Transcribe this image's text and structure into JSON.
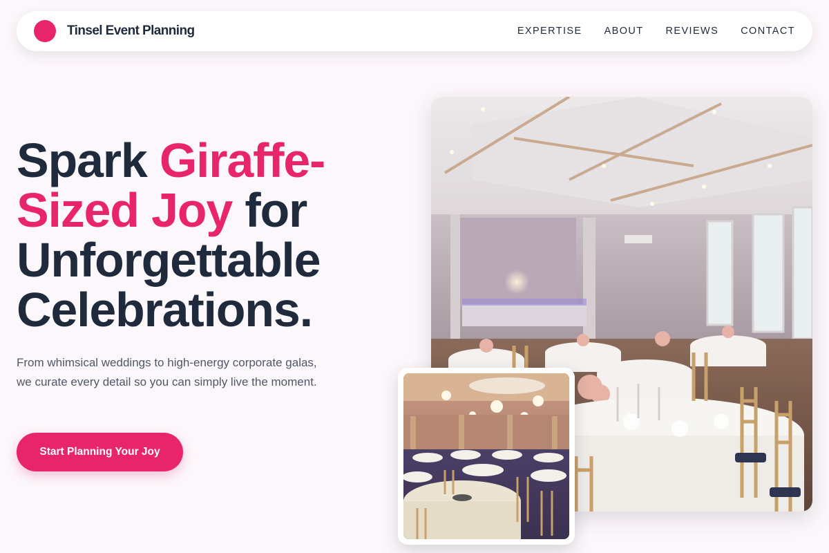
{
  "nav": {
    "brand": "Tinsel Event Planning",
    "links": [
      "EXPERTISE",
      "ABOUT",
      "REVIEWS",
      "CONTACT"
    ]
  },
  "hero": {
    "headline_part1": "Spark ",
    "headline_accent": "Giraffe-Sized Joy",
    "headline_part2": " for Unforgettable Celebrations.",
    "subtext": "From whimsical weddings to high-energy corporate galas, we curate every detail so you can simply live the moment.",
    "cta_label": "Start Planning Your Joy"
  },
  "images": {
    "main": "wedding-banquet-hall-photo",
    "inset": "ballroom-round-tables-photo"
  },
  "colors": {
    "accent": "#e8246b",
    "text_dark": "#1f2a3c",
    "text_muted": "#4f5868",
    "background": "#fcf7fa"
  }
}
